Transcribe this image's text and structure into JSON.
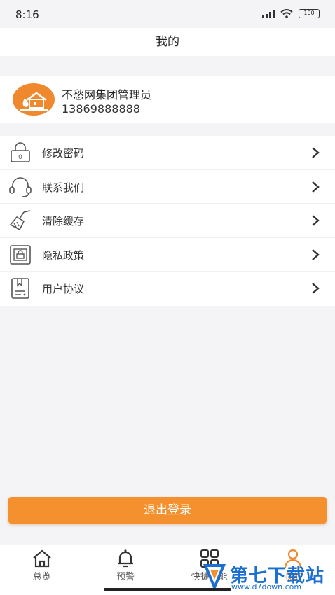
{
  "status_bar": {
    "time": "8:16",
    "battery": "100"
  },
  "header": {
    "title": "我的"
  },
  "profile": {
    "name": "不愁网集团管理员",
    "phone": "13869888888"
  },
  "menu": {
    "items": [
      {
        "label": "修改密码",
        "icon": "lock-icon"
      },
      {
        "label": "联系我们",
        "icon": "headset-icon"
      },
      {
        "label": "清除缓存",
        "icon": "broom-icon"
      },
      {
        "label": "隐私政策",
        "icon": "privacy-icon"
      },
      {
        "label": "用户协议",
        "icon": "agreement-icon"
      }
    ]
  },
  "logout": {
    "label": "退出登录"
  },
  "tabbar": {
    "tabs": [
      {
        "label": "总览",
        "icon": "home-icon"
      },
      {
        "label": "预警",
        "icon": "bell-icon"
      },
      {
        "label": "快捷功能",
        "icon": "grid-icon"
      },
      {
        "label": "我的",
        "icon": "user-icon",
        "active": true
      }
    ]
  },
  "watermark": {
    "brand": "第七下载站",
    "url": "www.d7down.com"
  },
  "colors": {
    "accent": "#f5902e",
    "background": "#f4f4f6",
    "watermark": "#1b6fd0"
  }
}
